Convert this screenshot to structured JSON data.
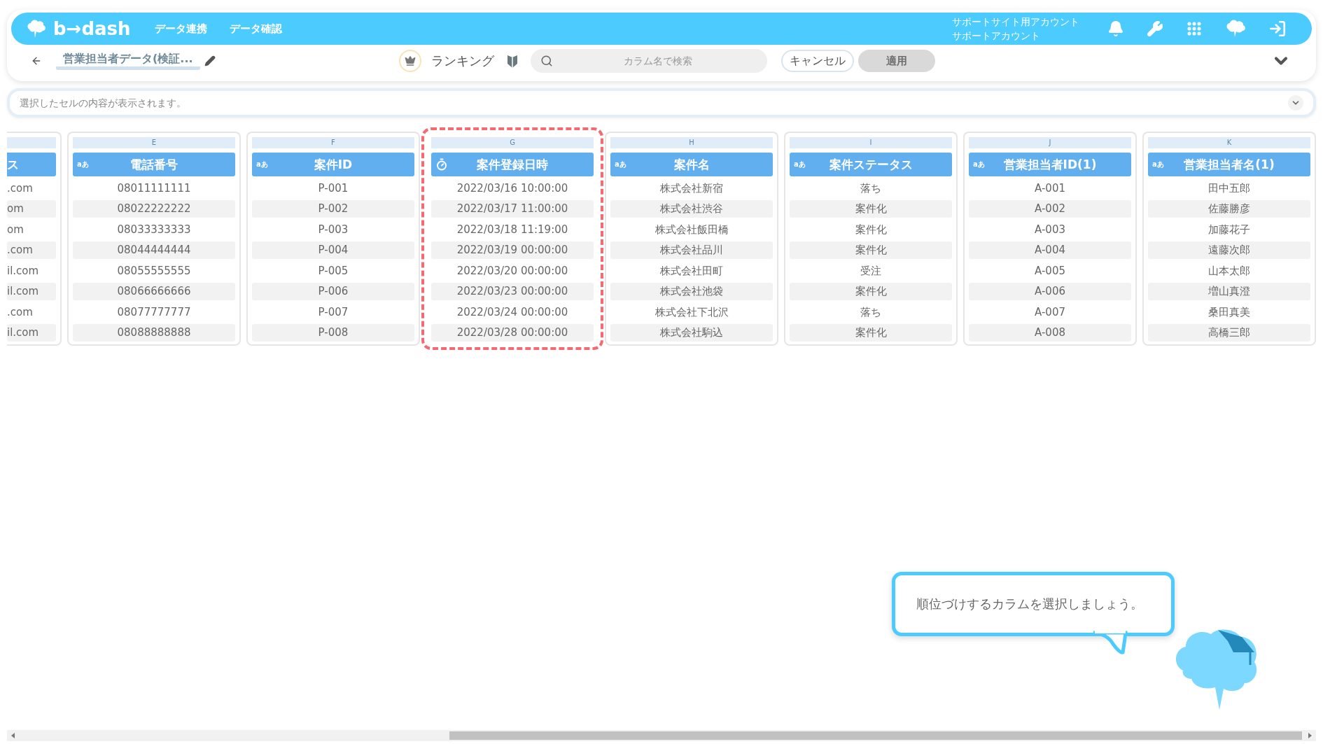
{
  "header": {
    "logo": "b→dash",
    "nav": [
      {
        "label": "データ連携"
      },
      {
        "label": "データ確認"
      }
    ],
    "account": [
      "サポートサイト用アカウント",
      "サポートアカウント"
    ]
  },
  "toolbar": {
    "title": "営業担当者データ(検証...",
    "mode": "ランキング",
    "search": {
      "placeholder": "カラム名で検索"
    },
    "cancel": "キャンセル",
    "apply": {
      "label": "適用",
      "disabled": true
    }
  },
  "cell_bar": {
    "placeholder": "選択したセルの内容が表示されます。"
  },
  "columns": [
    {
      "kind": "text",
      "title": "ス",
      "selected": false,
      "partial": true,
      "cells": [
        ".com",
        "om",
        "om",
        ".com",
        "il.com",
        "il.com",
        ".com",
        "il.com"
      ]
    },
    {
      "kind": "text",
      "letter": "E",
      "type_label": "aあ",
      "title": "電話番号",
      "selected": false,
      "cells": [
        "08011111111",
        "08022222222",
        "08033333333",
        "08044444444",
        "08055555555",
        "08066666666",
        "08077777777",
        "08088888888"
      ]
    },
    {
      "kind": "text",
      "letter": "F",
      "type_label": "aあ",
      "title": "案件ID",
      "selected": false,
      "cells": [
        "P-001",
        "P-002",
        "P-003",
        "P-004",
        "P-005",
        "P-006",
        "P-007",
        "P-008"
      ]
    },
    {
      "kind": "datetime",
      "letter": "G",
      "title": "案件登録日時",
      "selected": true,
      "cells": [
        "2022/03/16 10:00:00",
        "2022/03/17 11:00:00",
        "2022/03/18 11:19:00",
        "2022/03/19 00:00:00",
        "2022/03/20 00:00:00",
        "2022/03/23 00:00:00",
        "2022/03/24 00:00:00",
        "2022/03/28 00:00:00"
      ]
    },
    {
      "kind": "text",
      "letter": "H",
      "type_label": "aあ",
      "title": "案件名",
      "selected": false,
      "cells": [
        "株式会社新宿",
        "株式会社渋谷",
        "株式会社飯田橋",
        "株式会社品川",
        "株式会社田町",
        "株式会社池袋",
        "株式会社下北沢",
        "株式会社駒込"
      ]
    },
    {
      "kind": "text",
      "letter": "I",
      "type_label": "aあ",
      "title": "案件ステータス",
      "selected": false,
      "cells": [
        "落ち",
        "案件化",
        "案件化",
        "案件化",
        "受注",
        "案件化",
        "落ち",
        "案件化"
      ]
    },
    {
      "kind": "text",
      "letter": "J",
      "type_label": "aあ",
      "title": "営業担当者ID(1)",
      "selected": false,
      "cells": [
        "A-001",
        "A-002",
        "A-003",
        "A-004",
        "A-005",
        "A-006",
        "A-007",
        "A-008"
      ]
    },
    {
      "kind": "text",
      "letter": "K",
      "type_label": "aあ",
      "title": "営業担当者名(1)",
      "selected": false,
      "cells": [
        "田中五郎",
        "佐藤勝彦",
        "加藤花子",
        "遠藤次郎",
        "山本太郎",
        "増山真澄",
        "桑田真美",
        "高橋三郎"
      ]
    }
  ],
  "tooltip": {
    "text": "順位づけするカラムを選択しましょう。"
  }
}
